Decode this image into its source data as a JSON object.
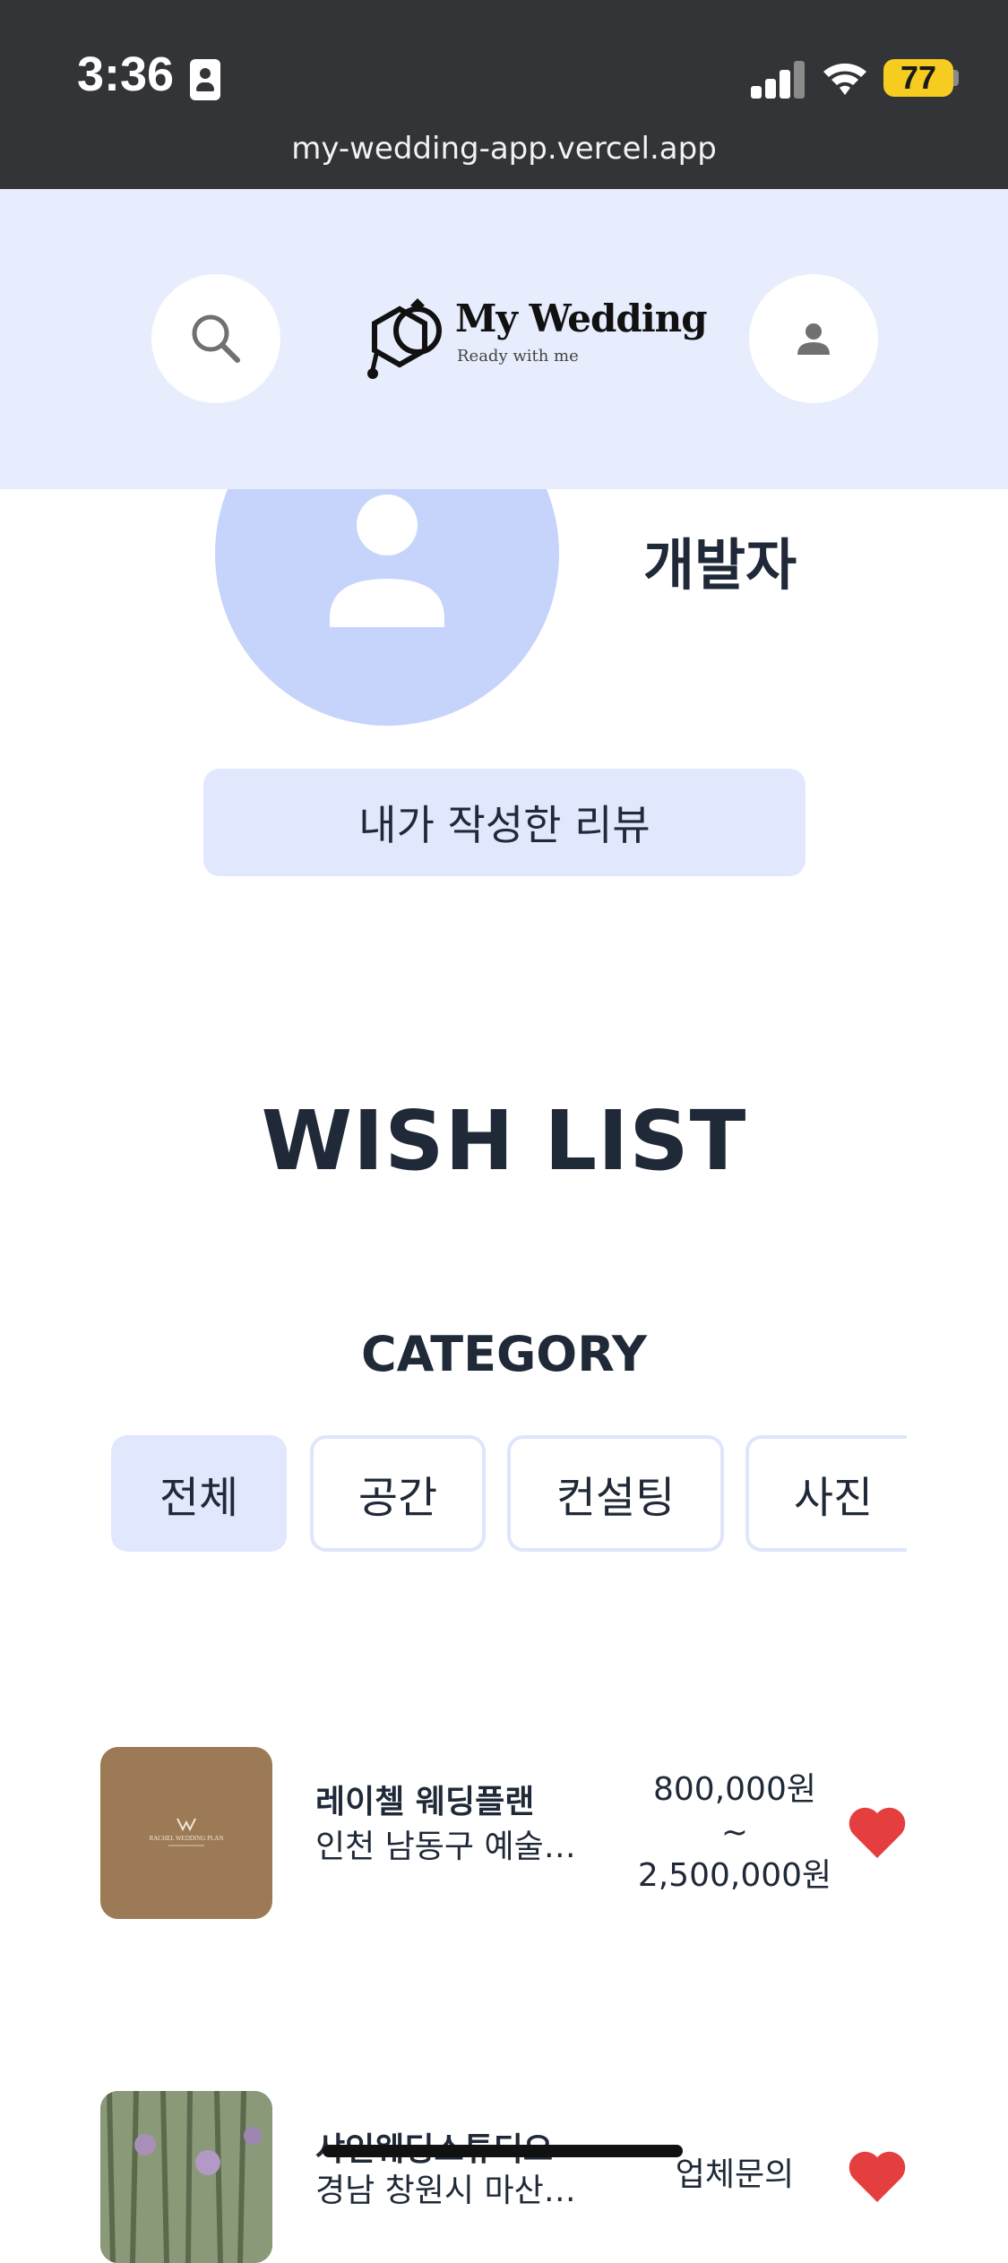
{
  "status_bar": {
    "time": "3:36",
    "battery": "77",
    "url": "my-wedding-app.vercel.app",
    "battery_color": "#f5cc1f"
  },
  "header": {
    "logo_title": "My Wedding",
    "logo_subtitle": "Ready with me",
    "search_icon": "search-icon",
    "profile_icon": "user-icon"
  },
  "profile": {
    "name": "개발자",
    "my_reviews_button": "내가 작성한 리뷰"
  },
  "wishlist": {
    "title": "WISH LIST",
    "category_title": "CATEGORY",
    "categories": [
      {
        "label": "전체",
        "active": true
      },
      {
        "label": "공간",
        "active": false
      },
      {
        "label": "컨설팅",
        "active": false
      },
      {
        "label": "사진",
        "active": false
      }
    ],
    "items": [
      {
        "name": "레이첼 웨딩플랜",
        "location": "인천 남동구 예술…",
        "price_min": "800,000원",
        "price_sep": "~",
        "price_max": "2,500,000원",
        "thumb_text": "RACHEL WEDDING PLAN",
        "favorited": true
      },
      {
        "name": "샤인웨딩스튜디오",
        "location": "경남 창원시 마산…",
        "price_min": "업체문의",
        "favorited": true
      }
    ]
  },
  "colors": {
    "header_bg": "#e7edfc",
    "accent_light": "#e1e8fd",
    "avatar_bg": "#c6d3fb",
    "heart": "#e53e3e",
    "text": "#1f2937"
  }
}
